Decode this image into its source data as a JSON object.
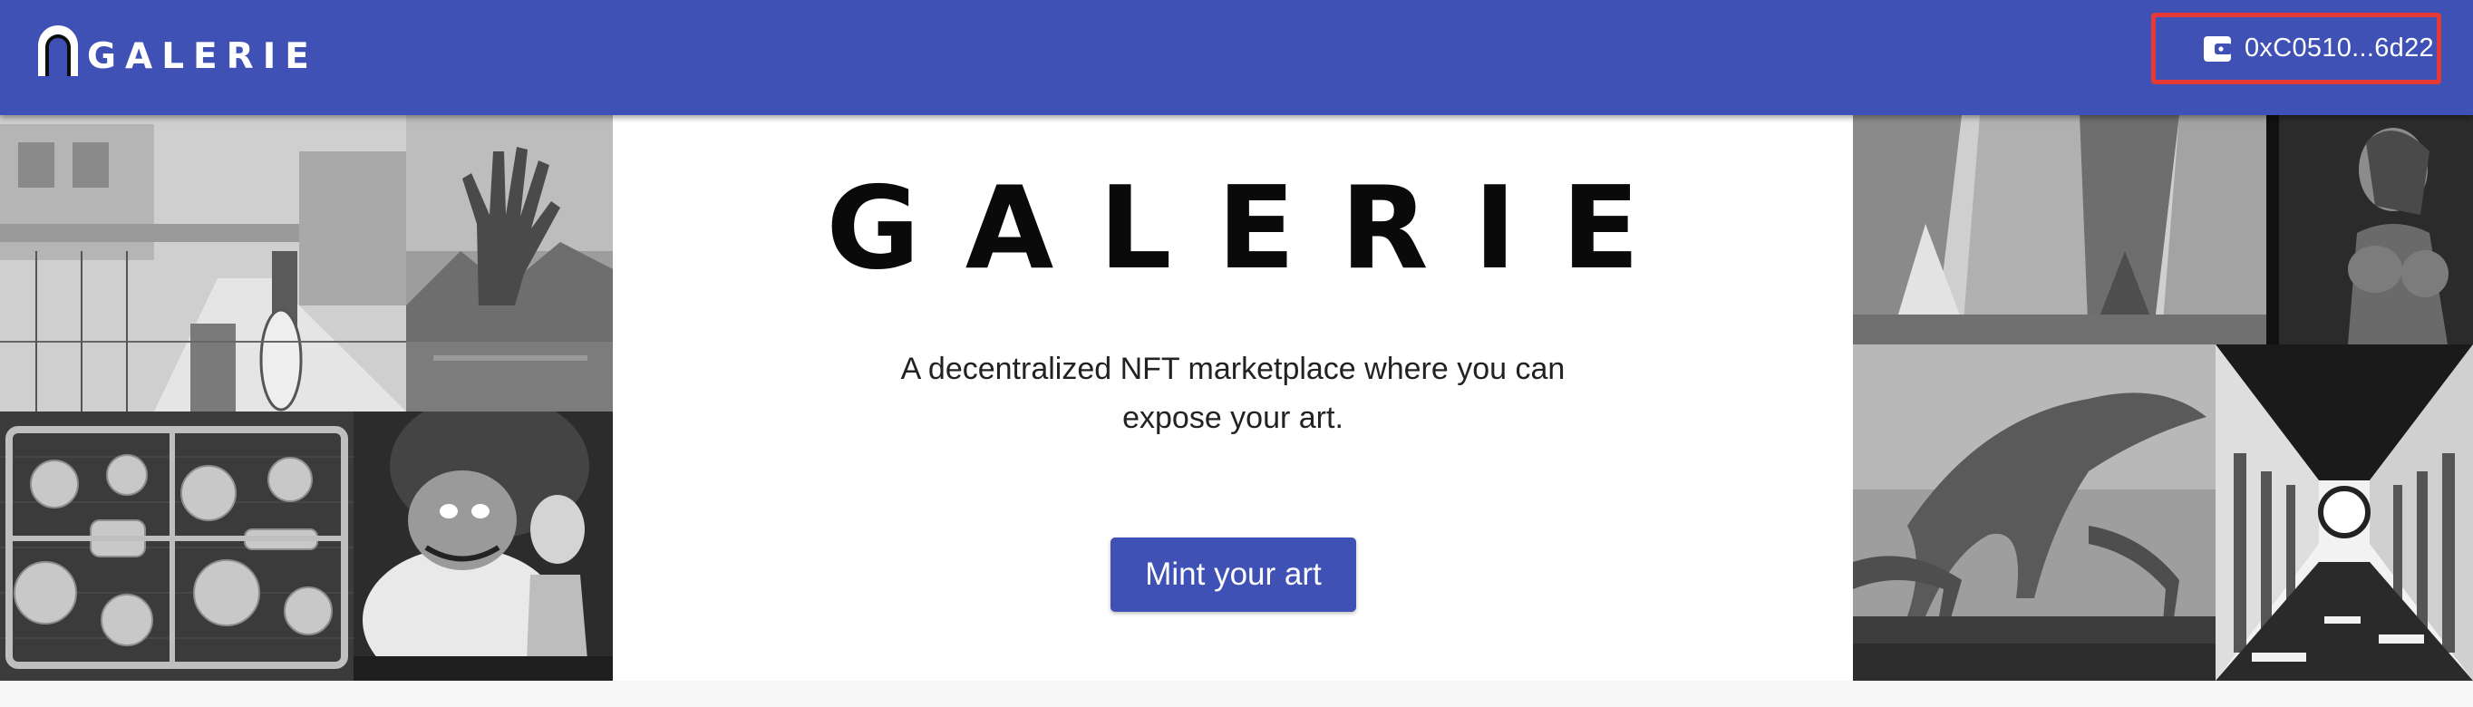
{
  "header": {
    "logo_text": "GALERIE",
    "wallet_address": "0xC0510...6d22",
    "wallet_icon": "wallet-icon"
  },
  "hero": {
    "title": "GALERIE",
    "subtitle_line1": "A decentralized NFT marketplace where you can",
    "subtitle_line2": "expose your art.",
    "cta_label": "Mint your art"
  },
  "gallery": {
    "left": [
      "village-sketch-artwork",
      "giant-hand-artwork",
      "model-kit-artwork",
      "cartoon-characters-artwork"
    ],
    "right": [
      "cliffs-artwork",
      "woman-portrait-artwork",
      "creature-trees-artwork",
      "columns-hall-artwork"
    ]
  },
  "colors": {
    "primary": "#3f51b5",
    "highlight_border": "#e53935",
    "title_text": "#0a0a0a"
  }
}
